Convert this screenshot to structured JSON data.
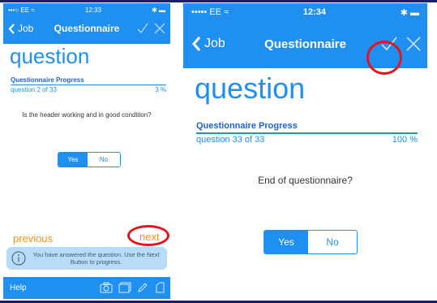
{
  "left": {
    "status": {
      "carrier": "•••○ EE ≈",
      "time": "12:33",
      "battery": "✱ ▬"
    },
    "nav": {
      "back": "Job",
      "title": "Questionnaire"
    },
    "heading": "question",
    "progress_label": "Questionnaire Progress",
    "progress_text": "question 2 of 33",
    "progress_pct": "3 %",
    "question": "Is the header working and in good condition?",
    "yes": "Yes",
    "no": "No",
    "previous": "previous",
    "next": "next",
    "hint": "You have answered the question. Use the Next Button to progress.",
    "help": "Help"
  },
  "right": {
    "status": {
      "carrier": "••••• EE ≈",
      "time": "12:34",
      "battery": "✱ ▬"
    },
    "nav": {
      "back": "Job",
      "title": "Questionnaire"
    },
    "heading": "question",
    "progress_label": "Questionnaire Progress",
    "progress_text": "question 33 of 33",
    "progress_pct": "100 %",
    "question": "End of questionnaire?",
    "yes": "Yes",
    "no": "No"
  },
  "colors": {
    "accent": "#1f8ff0",
    "highlight": "#e3151c",
    "nav_orange": "#f39222"
  },
  "selected_answer": "Yes"
}
